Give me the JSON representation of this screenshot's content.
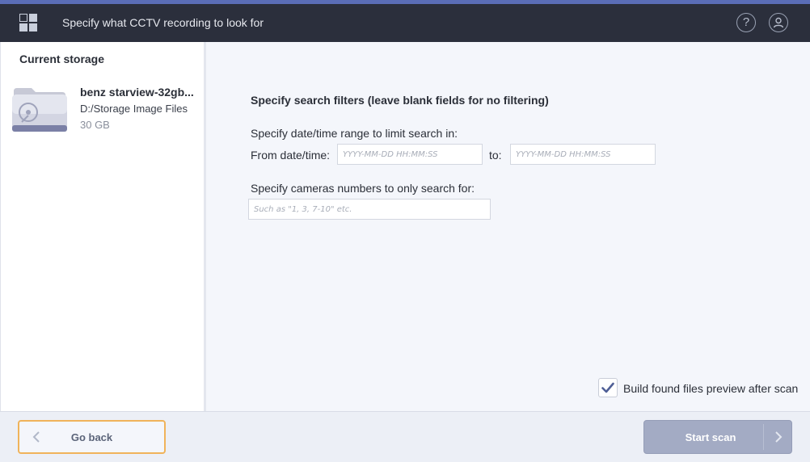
{
  "window": {
    "title": "Specify what CCTV recording to look for",
    "help_icon": "question-circle-icon",
    "help_glyph": "?",
    "account_icon": "user-circle-icon"
  },
  "sidebar": {
    "heading": "Current storage",
    "storage": {
      "icon": "disk-folder-icon",
      "name": "benz starview-32gb...",
      "path": "D:/Storage Image Files",
      "size": "30 GB"
    }
  },
  "filters": {
    "heading": "Specify search filters (leave blank fields for no filtering)",
    "date_range_label": "Specify date/time range to limit search in:",
    "from_label": "From date/time:",
    "from_value": "",
    "from_placeholder": "YYYY-MM-DD HH:MM:SS",
    "to_label": "to:",
    "to_value": "",
    "to_placeholder": "YYYY-MM-DD HH:MM:SS",
    "cameras_label": "Specify cameras numbers to only search for:",
    "cameras_value": "",
    "cameras_placeholder": "Such as \"1, 3, 7-10\" etc.",
    "preview_checkbox_label": "Build found files preview after scan",
    "preview_checked": true
  },
  "footer": {
    "back_label": "Go back",
    "scan_label": "Start scan"
  },
  "colors": {
    "titlebar": "#2b2f3c",
    "accent": "#5a6db6",
    "back_border": "#f0b35a",
    "scan_button": "#a3abc4"
  }
}
